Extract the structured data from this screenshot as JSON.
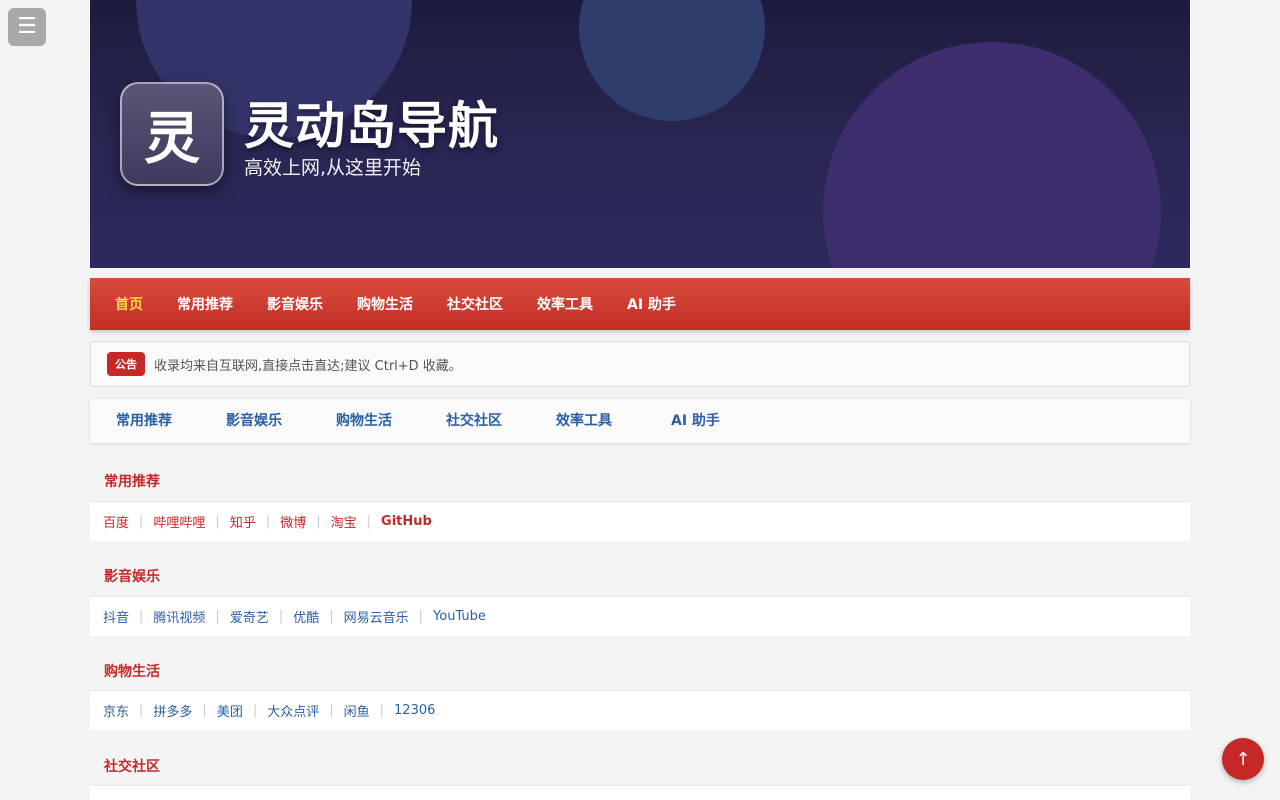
{
  "menu_toggle": {
    "icon": "hamburger-menu-icon",
    "glyph": "☰"
  },
  "banner": {
    "logo_char": "灵",
    "title": "灵动岛导航",
    "subtitle": "高效上网,从这里开始"
  },
  "topnav": {
    "items": [
      {
        "label": "首页",
        "active": true
      },
      {
        "label": "常用推荐"
      },
      {
        "label": "影音娱乐"
      },
      {
        "label": "购物生活"
      },
      {
        "label": "社交社区"
      },
      {
        "label": "效率工具"
      },
      {
        "label": "AI 助手"
      }
    ]
  },
  "notice": {
    "badge": "公告",
    "text": "收录均来自互联网,直接点击直达;建议 Ctrl+D 收藏。"
  },
  "tabs": [
    "常用推荐",
    "影音娱乐",
    "购物生活",
    "社交社区",
    "效率工具",
    "AI 助手"
  ],
  "sections": [
    {
      "title": "常用推荐",
      "links": [
        "百度",
        "哔哩哔哩",
        "知乎",
        "微博",
        "淘宝",
        "GitHub"
      ]
    },
    {
      "title": "影音娱乐",
      "links": [
        "抖音",
        "腾讯视频",
        "爱奇艺",
        "优酷",
        "网易云音乐",
        "YouTube"
      ]
    },
    {
      "title": "购物生活",
      "links": [
        "京东",
        "拼多多",
        "美团",
        "大众点评",
        "闲鱼",
        "12306"
      ]
    },
    {
      "title": "社交社区"
    }
  ],
  "separator": "|",
  "back_to_top": {
    "icon": "arrow-up-icon",
    "glyph": "↑"
  },
  "colors": {
    "accent_red": "#c62828",
    "link_blue": "#2b5fa8",
    "active_nav": "#ffd54a"
  }
}
